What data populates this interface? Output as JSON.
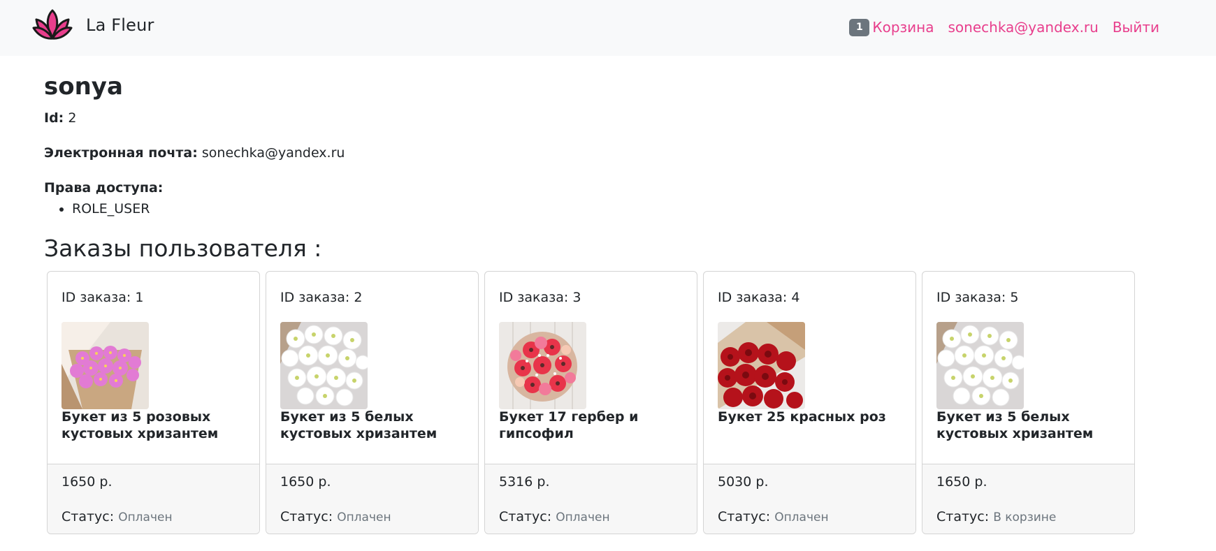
{
  "navbar": {
    "brand": "La Fleur",
    "cart_count": "1",
    "cart_label": "Корзина",
    "user_email": "sonechka@yandex.ru",
    "logout_label": "Выйти",
    "accent_color": "#e83e8c"
  },
  "profile": {
    "username": "sonya",
    "id_label": "Id:",
    "id_value": "2",
    "email_label": "Электронная почта:",
    "email_value": "sonechka@yandex.ru",
    "roles_label": "Права доступа:",
    "roles": [
      "ROLE_USER"
    ]
  },
  "orders_title": "Заказы пользователя :",
  "orders": [
    {
      "id_label": "ID заказа: 1",
      "product": "Букет из 5 розовых кустовых хризантем",
      "price": "1650 р.",
      "status_label": "Статус:",
      "status": "Оплачен",
      "image": "pink-chrysanthemum-bouquet"
    },
    {
      "id_label": "ID заказа: 2",
      "product": "Букет из 5 белых кустовых хризантем",
      "price": "1650 р.",
      "status_label": "Статус:",
      "status": "Оплачен",
      "image": "white-chrysanthemum-bouquet"
    },
    {
      "id_label": "ID заказа: 3",
      "product": "Букет 17 гербер и гипсофил",
      "price": "5316 р.",
      "status_label": "Статус:",
      "status": "Оплачен",
      "image": "gerbera-bouquet"
    },
    {
      "id_label": "ID заказа: 4",
      "product": "Букет 25 красных роз",
      "price": "5030 р.",
      "status_label": "Статус:",
      "status": "Оплачен",
      "image": "red-roses-bouquet"
    },
    {
      "id_label": "ID заказа: 5",
      "product": "Букет из 5 белых кустовых хризантем",
      "price": "1650 р.",
      "status_label": "Статус:",
      "status": "В корзине",
      "image": "white-chrysanthemum-bouquet"
    }
  ]
}
